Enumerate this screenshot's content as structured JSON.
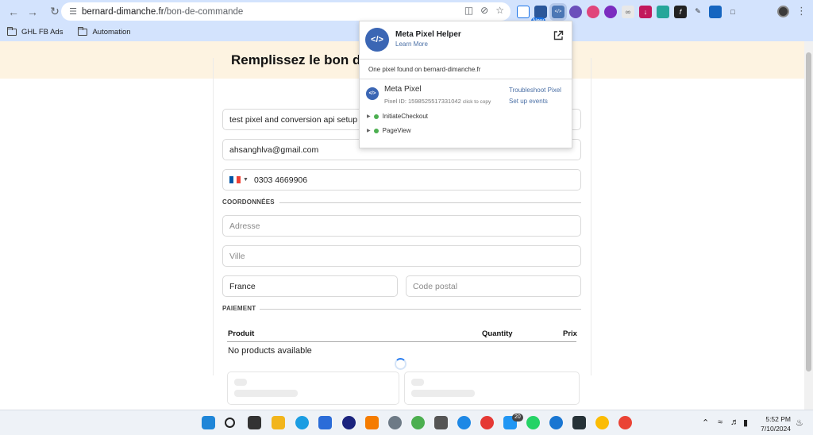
{
  "browser": {
    "url_host": "bernard-dimanche.fr",
    "url_path": "/bon-de-commande",
    "extensions": {
      "new_badge": "New",
      "pixel_helper_badge": "</>"
    },
    "bookmarks": [
      {
        "label": "GHL FB Ads"
      },
      {
        "label": "Automation"
      }
    ]
  },
  "page": {
    "title": "Remplissez le bon de",
    "fields": {
      "name_value": "test pixel and conversion api setup",
      "email_value": "ahsanghlva@gmail.com",
      "phone_value": "0303 4669906",
      "address_placeholder": "Adresse",
      "city_placeholder": "Ville",
      "country_value": "France",
      "postal_placeholder": "Code postal"
    },
    "sections": {
      "coordinates": "COORDONNÉES",
      "payment": "PAIEMENT"
    },
    "products_table": {
      "headers": [
        "Produit",
        "Quantity",
        "Prix"
      ],
      "empty_text": "No products available"
    }
  },
  "popup": {
    "logo": "</>",
    "title": "Meta Pixel Helper",
    "learn_more": "Learn More",
    "found_text": "One pixel found on bernard-dimanche.fr",
    "pixel_name": "Meta Pixel",
    "pixel_id": "Pixel ID: 1598525517331042",
    "click_to_copy": "click to copy",
    "troubleshoot": "Troubleshoot Pixel",
    "setup_events": "Set up events",
    "events": [
      "InitiateCheckout",
      "PageView"
    ]
  },
  "taskbar": {
    "whatsapp_badge": "20",
    "time": "5:52 PM",
    "date": "7/10/2024"
  },
  "colors": {
    "browser_chrome": "#d3e3fd",
    "banner": "#fdf3e1",
    "meta_blue": "#3b66b4",
    "link_blue": "#4a6fa5",
    "event_green": "#4caf50"
  }
}
